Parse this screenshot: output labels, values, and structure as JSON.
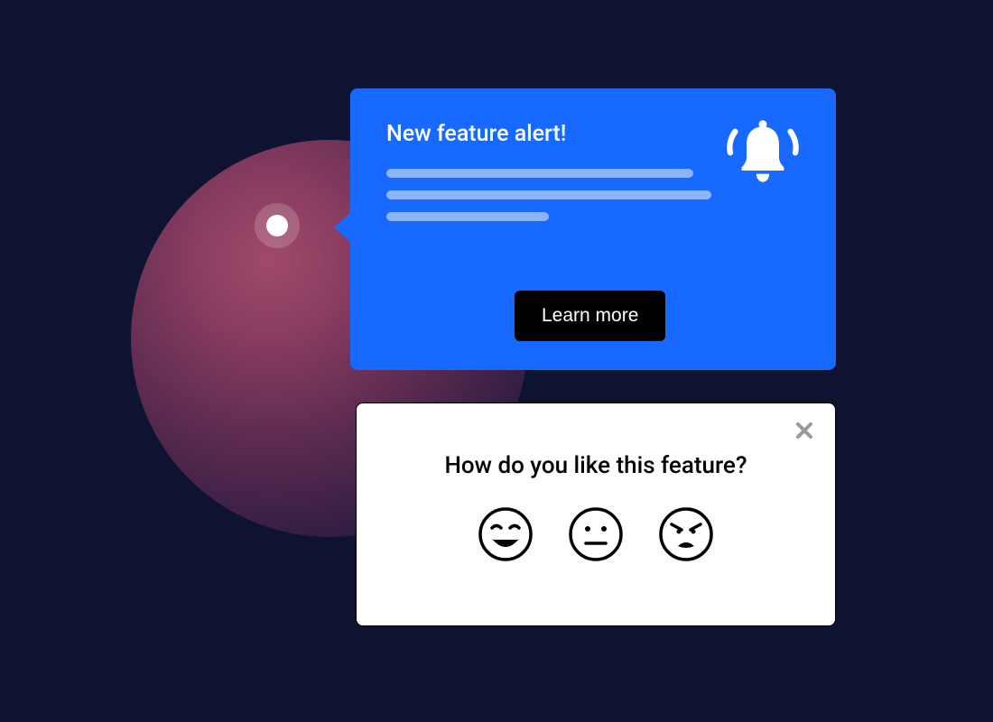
{
  "tooltip": {
    "title": "New feature alert!",
    "cta_label": "Learn more"
  },
  "feedback": {
    "title": "How do you like this feature?"
  }
}
